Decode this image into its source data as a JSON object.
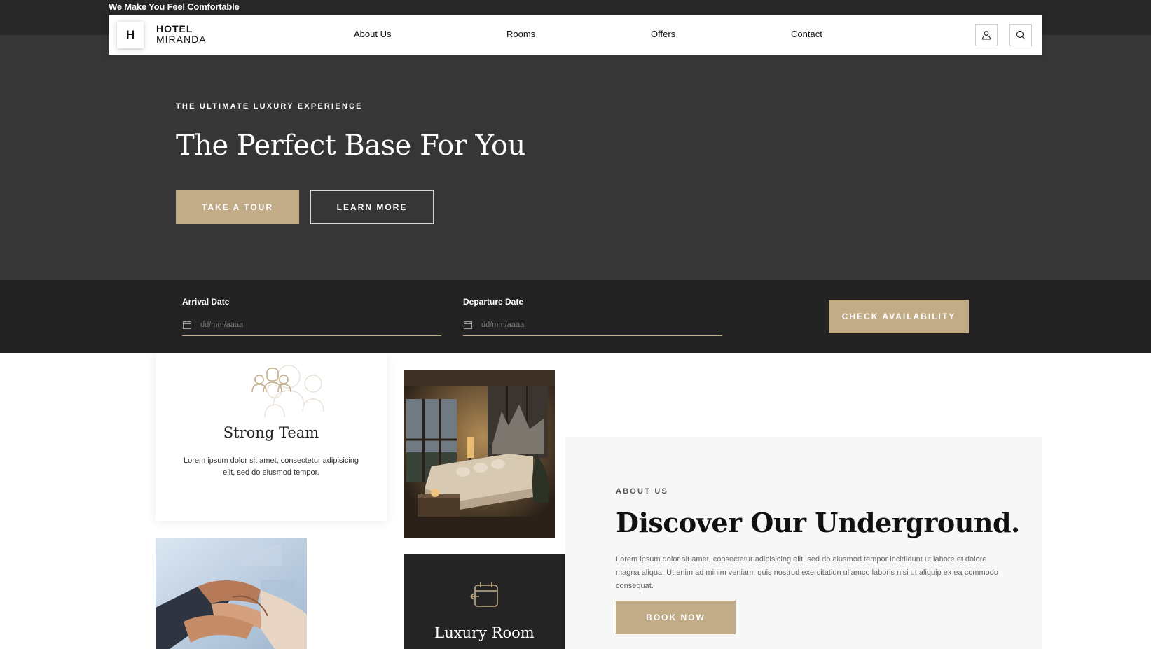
{
  "topbar": {
    "tagline": "We Make You Feel Comfortable"
  },
  "header": {
    "logo_letter": "H",
    "logo_line1": "HOTEL",
    "logo_line2": "MIRANDA",
    "nav": [
      "About Us",
      "Rooms",
      "Offers",
      "Contact"
    ],
    "icons": [
      "user-icon",
      "search-icon"
    ]
  },
  "hero": {
    "eyebrow": "THE ULTIMATE LUXURY EXPERIENCE",
    "title": "The Perfect Base For You",
    "primary_button": "TAKE A TOUR",
    "secondary_button": "LEARN MORE"
  },
  "booking": {
    "arrival_label": "Arrival Date",
    "arrival_placeholder": "dd/mm/aaaa",
    "departure_label": "Departure Date",
    "departure_placeholder": "dd/mm/aaaa",
    "button": "CHECK AVAILABILITY"
  },
  "features": {
    "team": {
      "title": "Strong Team",
      "text": "Lorem ipsum dolor sit amet, consectetur adipisicing elit, sed do eiusmod tempor.",
      "icon": "team-icon"
    },
    "luxury": {
      "title": "Luxury Room",
      "icon": "calendar-icon"
    }
  },
  "about": {
    "eyebrow": "ABOUT US",
    "title": "Discover Our Underground.",
    "text": "Lorem ipsum dolor sit amet, consectetur adipisicing elit, sed do eiusmod tempor incididunt ut labore et dolore magna aliqua. Ut enim ad minim veniam, quis nostrud exercitation ullamco laboris nisi ut aliquip ex ea commodo consequat.",
    "button": "BOOK NOW"
  },
  "colors": {
    "accent": "#c2ab87",
    "dark": "#232323",
    "hero": "#363636"
  }
}
